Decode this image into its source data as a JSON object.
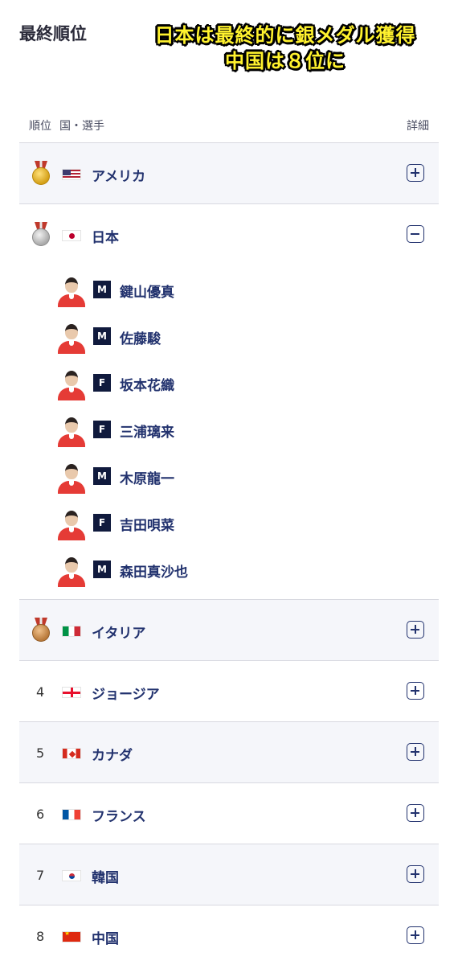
{
  "page_title": "最終順位",
  "overlay": {
    "line1": "日本は最終的に銀メダル獲得",
    "line2": "中国は８位に"
  },
  "table_header": {
    "rank": "順位",
    "country": "国・選手",
    "detail": "詳細"
  },
  "rows": [
    {
      "rank": "",
      "medal": "gold",
      "flag": "us",
      "country": "アメリカ",
      "expanded": false
    },
    {
      "rank": "",
      "medal": "silver",
      "flag": "jp",
      "country": "日本",
      "expanded": true,
      "athletes": [
        {
          "gender": "M",
          "name": "鍵山優真"
        },
        {
          "gender": "M",
          "name": "佐藤駿"
        },
        {
          "gender": "F",
          "name": "坂本花織"
        },
        {
          "gender": "F",
          "name": "三浦璃来"
        },
        {
          "gender": "M",
          "name": "木原龍一"
        },
        {
          "gender": "F",
          "name": "吉田唄菜"
        },
        {
          "gender": "M",
          "name": "森田真沙也"
        }
      ]
    },
    {
      "rank": "",
      "medal": "bronze",
      "flag": "it",
      "country": "イタリア",
      "expanded": false
    },
    {
      "rank": "4",
      "medal": "",
      "flag": "ge",
      "country": "ジョージア",
      "expanded": false
    },
    {
      "rank": "5",
      "medal": "",
      "flag": "ca",
      "country": "カナダ",
      "expanded": false
    },
    {
      "rank": "6",
      "medal": "",
      "flag": "fr",
      "country": "フランス",
      "expanded": false
    },
    {
      "rank": "7",
      "medal": "",
      "flag": "kr",
      "country": "韓国",
      "expanded": false
    },
    {
      "rank": "8",
      "medal": "",
      "flag": "cn",
      "country": "中国",
      "expanded": false
    }
  ]
}
